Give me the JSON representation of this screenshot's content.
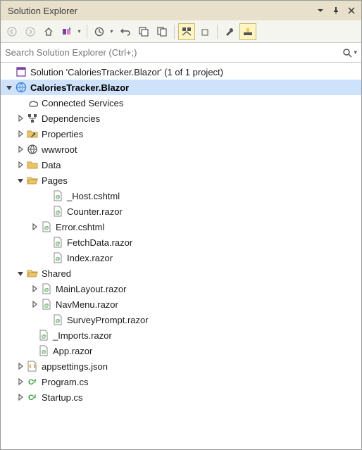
{
  "title": "Solution Explorer",
  "search_placeholder": "Search Solution Explorer (Ctrl+;)",
  "solution_line": "Solution 'CaloriesTracker.Blazor' (1 of 1 project)",
  "project_name": "CaloriesTracker.Blazor",
  "nodes": {
    "connected_services": "Connected Services",
    "dependencies": "Dependencies",
    "properties": "Properties",
    "wwwroot": "wwwroot",
    "data": "Data",
    "pages": "Pages",
    "pages_items": {
      "host": "_Host.cshtml",
      "counter": "Counter.razor",
      "error": "Error.cshtml",
      "fetchdata": "FetchData.razor",
      "index": "Index.razor"
    },
    "shared": "Shared",
    "shared_items": {
      "mainlayout": "MainLayout.razor",
      "navmenu": "NavMenu.razor",
      "surveyprompt": "SurveyPrompt.razor"
    },
    "imports": "_Imports.razor",
    "app": "App.razor",
    "appsettings": "appsettings.json",
    "program": "Program.cs",
    "startup": "Startup.cs"
  }
}
